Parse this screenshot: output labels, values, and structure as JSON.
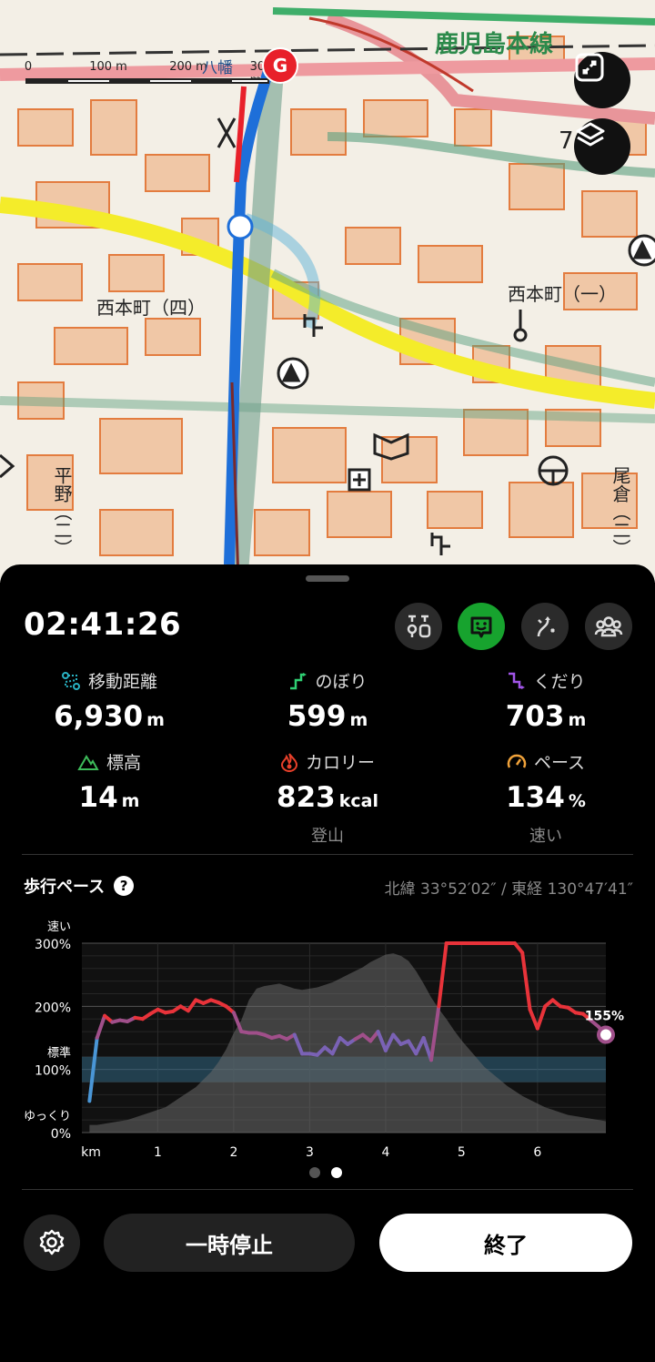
{
  "map": {
    "scale": {
      "labels": [
        "0",
        "100 m",
        "200 m",
        "300 m"
      ]
    },
    "labels": {
      "rail_line": "鹿児島本線",
      "station": "八幡",
      "district_4": "西本町（四）",
      "district_1": "西本町（一）",
      "hirano": "平野（二）",
      "ogura": "尾倉（二）",
      "edge_number": "7"
    },
    "goal_marker": "G",
    "colors": {
      "track": "#1e6fd9",
      "goal": "#e8202a",
      "route_glow": "#5fb3d8"
    }
  },
  "panel": {
    "timer": "02:41:26",
    "top_buttons": [
      {
        "icon": "pin-list-icon",
        "active": false
      },
      {
        "icon": "face-smile-icon",
        "active": true
      },
      {
        "icon": "route-icon",
        "active": false
      },
      {
        "icon": "group-icon",
        "active": false
      }
    ],
    "stats": [
      {
        "label": "移動距離",
        "value": "6,930",
        "unit": "m",
        "sub": "",
        "icon": "distance-icon",
        "color": "#29b3c4"
      },
      {
        "label": "のぼり",
        "value": "599",
        "unit": "m",
        "sub": "",
        "icon": "ascent-icon",
        "color": "#2fcf73"
      },
      {
        "label": "くだり",
        "value": "703",
        "unit": "m",
        "sub": "",
        "icon": "descent-icon",
        "color": "#a155e8"
      },
      {
        "label": "標高",
        "value": "14",
        "unit": "m",
        "sub": "",
        "icon": "mountain-icon",
        "color": "#3dbb5a"
      },
      {
        "label": "カロリー",
        "value": "823",
        "unit": "kcal",
        "sub": "登山",
        "icon": "flame-icon",
        "color": "#e8402a"
      },
      {
        "label": "ペース",
        "value": "134",
        "unit": "%",
        "sub": "速い",
        "icon": "gauge-icon",
        "color": "#f0a23a"
      }
    ],
    "pace_section": {
      "title": "歩行ペース",
      "help_glyph": "?",
      "coordinates": "北緯 33°52′02″ / 東経 130°47′41″"
    },
    "page_dots": 2,
    "active_dot": 1,
    "pause_label": "一時停止",
    "end_label": "終了"
  },
  "chart_data": {
    "type": "line",
    "title": "歩行ペース",
    "xlabel": "km",
    "x_ticks": [
      "1",
      "2",
      "3",
      "4",
      "5",
      "6"
    ],
    "xlim": [
      0,
      6.9
    ],
    "ylim": [
      0,
      300
    ],
    "y_ticks": [
      {
        "value": 300,
        "label": "300%",
        "top_label": "速い"
      },
      {
        "value": 200,
        "label": "200%",
        "top_label": ""
      },
      {
        "value": 100,
        "label": "100%",
        "top_label": "標準"
      },
      {
        "value": 0,
        "label": "0%",
        "top_label": "ゆっくり"
      }
    ],
    "standard_band": [
      80,
      120
    ],
    "current_label": "155%",
    "series": [
      {
        "x": [
          0.1,
          0.2,
          0.3,
          0.4,
          0.5,
          0.6,
          0.7,
          0.8,
          0.9,
          1.0,
          1.1,
          1.2,
          1.3,
          1.4,
          1.5,
          1.6,
          1.7,
          1.8,
          1.9,
          2.0,
          2.1,
          2.2,
          2.3,
          2.4,
          2.5,
          2.6,
          2.7,
          2.8,
          2.9,
          3.0,
          3.1,
          3.2,
          3.3,
          3.4,
          3.5,
          3.6,
          3.7,
          3.8,
          3.9,
          4.0,
          4.1,
          4.2,
          4.3,
          4.4,
          4.5,
          4.6,
          4.7,
          4.8,
          4.9,
          5.0,
          5.1,
          5.2,
          5.3,
          5.4,
          5.5,
          5.6,
          5.7,
          5.8,
          5.9,
          6.0,
          6.1,
          6.2,
          6.3,
          6.4,
          6.5,
          6.6,
          6.7,
          6.8,
          6.9
        ],
        "y": [
          50,
          150,
          185,
          175,
          178,
          176,
          182,
          180,
          188,
          195,
          190,
          192,
          200,
          193,
          210,
          205,
          210,
          206,
          200,
          190,
          160,
          158,
          158,
          155,
          150,
          153,
          148,
          155,
          125,
          125,
          123,
          135,
          125,
          150,
          140,
          148,
          155,
          145,
          160,
          130,
          155,
          140,
          145,
          125,
          150,
          115,
          200,
          300,
          300,
          300,
          300,
          300,
          300,
          300,
          300,
          300,
          300,
          285,
          195,
          165,
          200,
          210,
          200,
          198,
          190,
          188,
          178,
          168,
          155
        ]
      }
    ],
    "elevation_profile_y": [
      12,
      12,
      14,
      16,
      18,
      20,
      24,
      28,
      32,
      36,
      40,
      48,
      56,
      64,
      72,
      84,
      96,
      112,
      132,
      158,
      178,
      210,
      228,
      232,
      234,
      236,
      232,
      228,
      226,
      228,
      230,
      234,
      238,
      244,
      250,
      256,
      262,
      270,
      276,
      282,
      284,
      280,
      272,
      256,
      236,
      214,
      196,
      180,
      162,
      146,
      132,
      118,
      104,
      94,
      84,
      74,
      66,
      58,
      52,
      46,
      40,
      36,
      32,
      28,
      26,
      24,
      22,
      20,
      18
    ]
  }
}
